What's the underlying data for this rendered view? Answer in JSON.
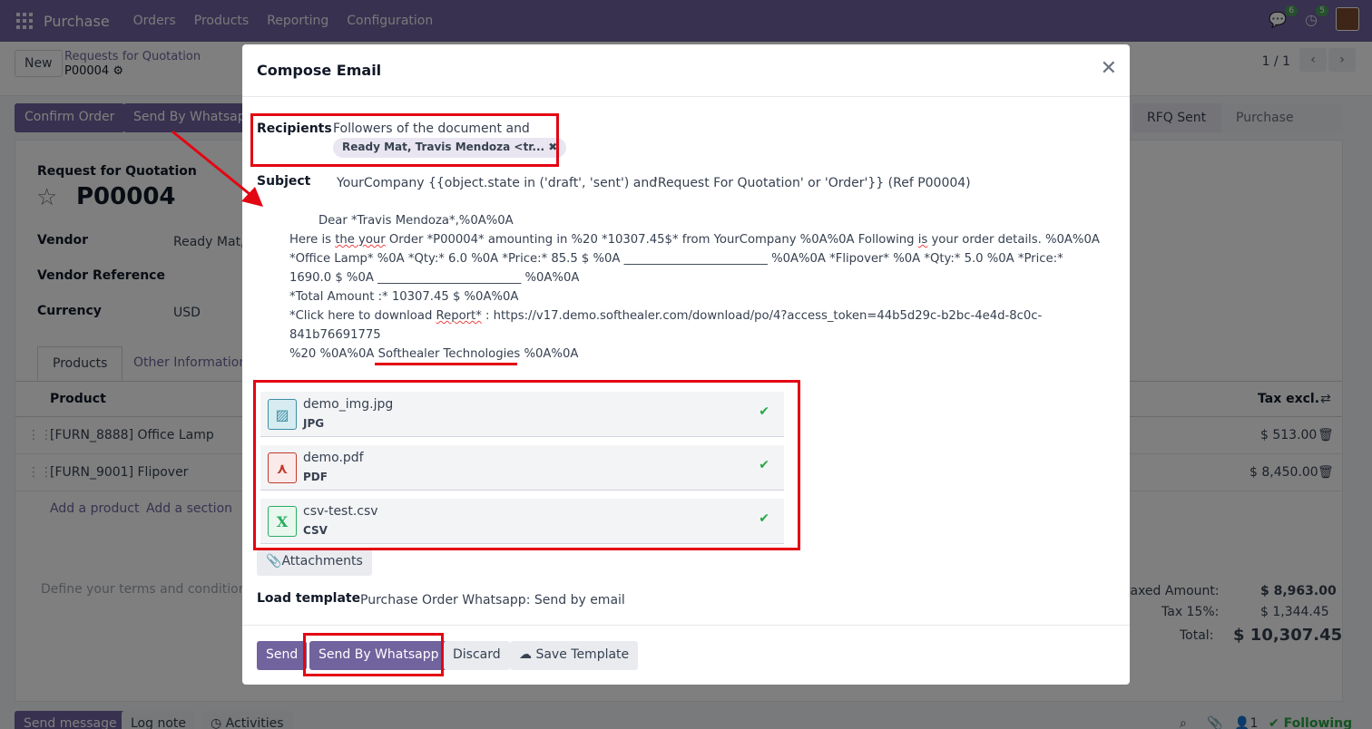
{
  "navbar": {
    "brand": "Purchase",
    "menu": [
      "Orders",
      "Products",
      "Reporting",
      "Configuration"
    ],
    "messages_count": "6",
    "activities_count": "5"
  },
  "control": {
    "new_label": "New",
    "breadcrumb_parent": "Requests for Quotation",
    "breadcrumb_record": "P00004",
    "pager": "1 / 1"
  },
  "form": {
    "buttons": [
      "Confirm Order",
      "Send By Whatsapp"
    ],
    "stages": [
      "RFQ Sent",
      "Purchase Order"
    ],
    "doc_type": "Request for Quotation",
    "doc_number": "P00004",
    "vendor_label": "Vendor",
    "vendor_value": "Ready Mat, T",
    "vendor_ref_label": "Vendor Reference",
    "currency_label": "Currency",
    "currency_value": "USD",
    "tabs": [
      "Products",
      "Other Information"
    ],
    "col_product": "Product",
    "col_tax": "Tax excl.",
    "lines": [
      {
        "product": "[FURN_8888] Office Lamp",
        "amount": "$ 513.00"
      },
      {
        "product": "[FURN_9001] Flipover",
        "amount": "$ 8,450.00"
      }
    ],
    "add_product": "Add a product",
    "add_section": "Add a section",
    "terms_placeholder": "Define your terms and conditions ...",
    "untaxed_label": "taxed Amount:",
    "untaxed_value": "$ 8,963.00",
    "tax_label": "Tax 15%:",
    "tax_value": "$ 1,344.45",
    "total_label": "Total:",
    "total_value": "$ 10,307.45"
  },
  "chatter": {
    "send_message": "Send message",
    "log_note": "Log note",
    "activities": "Activities",
    "followers": "1",
    "following": "Following"
  },
  "modal": {
    "title": "Compose Email",
    "recipients_label": "Recipients",
    "recipients_text": "Followers of the document and",
    "recipient_tag": "Ready Mat, Travis Mendoza <tr...",
    "subject_label": "Subject",
    "subject_part1": "YourCompany {{object.state in ('draft', 'sent') and",
    "subject_part2": "'Request For Quotation' or 'Order'}} (Ref P00004)",
    "body": {
      "line1": "Dear *Travis Mendoza*,%0A%0A",
      "line2_a": "Here is ",
      "line2_b": "the your",
      "line2_c": " Order *P00004* amounting in %20 *10307.45$* from YourCompany %0A%0A Following ",
      "line2_d": "is",
      "line2_e": " your order details. %0A%0A",
      "line3": "*Office Lamp* %0A *Qty:* 6.0 %0A *Price:* 85.5 $ %0A ________________________ %0A%0A *Flipover* %0A *Qty:* 5.0 %0A *Price:*",
      "line4": "1690.0 $ %0A ________________________ %0A%0A",
      "line5": "*Total Amount :* 10307.45 $ %0A%0A",
      "line6_a": "*Click here to download ",
      "line6_b": "Report*",
      "line6_c": " : https://v17.demo.softhealer.com/download/po/4?access_token=44b5d29c-b2bc-4e4d-8c0c-",
      "line7": "841b76691775",
      "line8_a": "%20 %0A%0A ",
      "line8_b": "Softhealer Technologies",
      "line8_c": " %0A%0A"
    },
    "attachments": [
      {
        "name": "demo_img.jpg",
        "ext": "JPG",
        "icon": "image-file-icon",
        "color": "#3b8ea5"
      },
      {
        "name": "demo.pdf",
        "ext": "PDF",
        "icon": "pdf-file-icon",
        "color": "#c0392b"
      },
      {
        "name": "csv-test.csv",
        "ext": "CSV",
        "icon": "spreadsheet-file-icon",
        "color": "#27ae60"
      }
    ],
    "attachments_button": "Attachments",
    "load_template_label": "Load template",
    "load_template_value": "Purchase Order Whatsapp: Send by email",
    "footer": {
      "send": "Send",
      "send_whatsapp": "Send By Whatsapp",
      "discard": "Discard",
      "save_template": "Save Template"
    }
  }
}
